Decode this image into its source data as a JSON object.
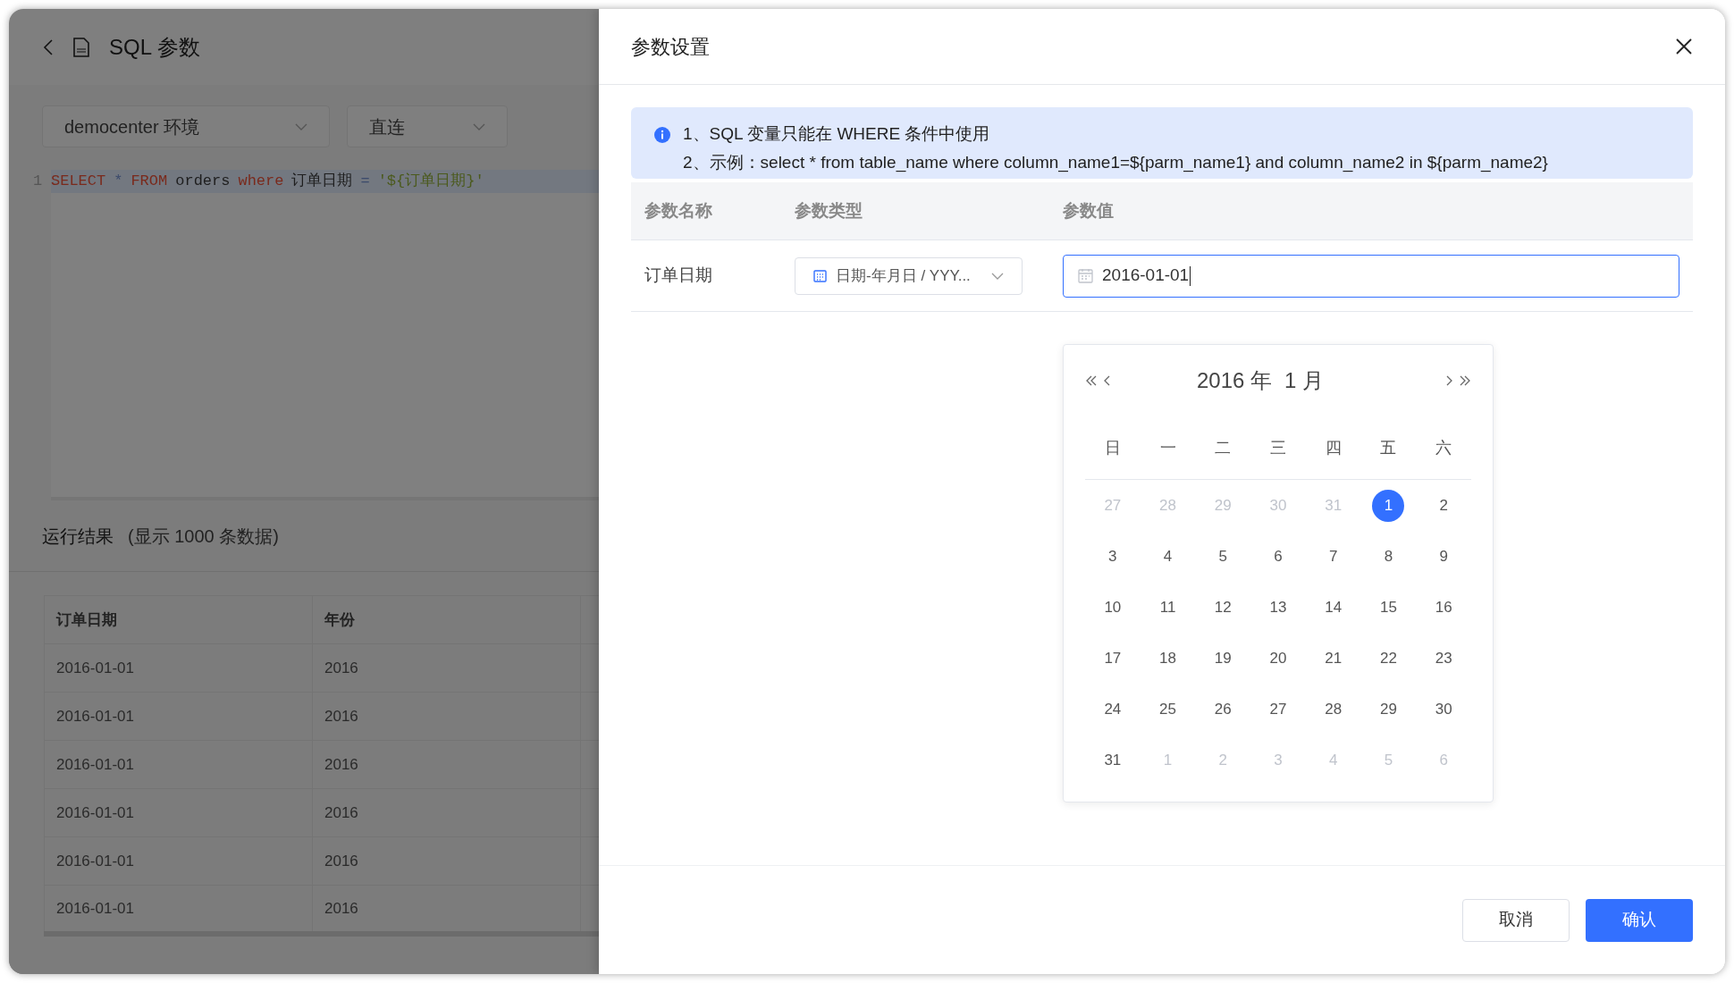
{
  "page": {
    "title": "SQL 参数"
  },
  "toolbar": {
    "environment": "democenter 环境",
    "connection": "直连"
  },
  "editor": {
    "lines": [
      {
        "number": "1",
        "tokens": [
          {
            "kind": "keyword",
            "text": "SELECT"
          },
          {
            "kind": "operator",
            "text": "*"
          },
          {
            "kind": "keyword",
            "text": "FROM"
          },
          {
            "kind": "plain",
            "text": "orders"
          },
          {
            "kind": "keyword",
            "text": "where"
          },
          {
            "kind": "plain",
            "text": "订单日期"
          },
          {
            "kind": "operator",
            "text": "="
          },
          {
            "kind": "string",
            "text": "'${订单日期}'"
          }
        ]
      }
    ]
  },
  "results": {
    "title": "运行结果",
    "note": "(显示 1000 条数据)",
    "columns": [
      "订单日期",
      "年份"
    ],
    "rows": [
      [
        "2016-01-01",
        "2016"
      ],
      [
        "2016-01-01",
        "2016"
      ],
      [
        "2016-01-01",
        "2016"
      ],
      [
        "2016-01-01",
        "2016"
      ],
      [
        "2016-01-01",
        "2016"
      ],
      [
        "2016-01-01",
        "2016"
      ]
    ]
  },
  "drawer": {
    "title": "参数设置",
    "alert": [
      "1、SQL 变量只能在 WHERE 条件中使用",
      "2、示例：select * from table_name where column_name1=${parm_name1} and column_name2 in ${parm_name2}"
    ],
    "columns": [
      "参数名称",
      "参数类型",
      "参数值"
    ],
    "params": [
      {
        "name": "订单日期",
        "type": "日期-年月日 / YYY...",
        "value": "2016-01-01"
      }
    ],
    "buttons": [
      {
        "label": "取消",
        "kind": "secondary"
      },
      {
        "label": "确认",
        "kind": "primary"
      }
    ]
  },
  "calendar": {
    "year": "2016 年",
    "month": "1 月",
    "weekdays": [
      "日",
      "一",
      "二",
      "三",
      "四",
      "五",
      "六"
    ],
    "days": [
      {
        "label": "27",
        "outside": true,
        "selected": false
      },
      {
        "label": "28",
        "outside": true,
        "selected": false
      },
      {
        "label": "29",
        "outside": true,
        "selected": false
      },
      {
        "label": "30",
        "outside": true,
        "selected": false
      },
      {
        "label": "31",
        "outside": true,
        "selected": false
      },
      {
        "label": "1",
        "outside": false,
        "selected": true
      },
      {
        "label": "2",
        "outside": false,
        "selected": false
      },
      {
        "label": "3",
        "outside": false,
        "selected": false
      },
      {
        "label": "4",
        "outside": false,
        "selected": false
      },
      {
        "label": "5",
        "outside": false,
        "selected": false
      },
      {
        "label": "6",
        "outside": false,
        "selected": false
      },
      {
        "label": "7",
        "outside": false,
        "selected": false
      },
      {
        "label": "8",
        "outside": false,
        "selected": false
      },
      {
        "label": "9",
        "outside": false,
        "selected": false
      },
      {
        "label": "10",
        "outside": false,
        "selected": false
      },
      {
        "label": "11",
        "outside": false,
        "selected": false
      },
      {
        "label": "12",
        "outside": false,
        "selected": false
      },
      {
        "label": "13",
        "outside": false,
        "selected": false
      },
      {
        "label": "14",
        "outside": false,
        "selected": false
      },
      {
        "label": "15",
        "outside": false,
        "selected": false
      },
      {
        "label": "16",
        "outside": false,
        "selected": false
      },
      {
        "label": "17",
        "outside": false,
        "selected": false
      },
      {
        "label": "18",
        "outside": false,
        "selected": false
      },
      {
        "label": "19",
        "outside": false,
        "selected": false
      },
      {
        "label": "20",
        "outside": false,
        "selected": false
      },
      {
        "label": "21",
        "outside": false,
        "selected": false
      },
      {
        "label": "22",
        "outside": false,
        "selected": false
      },
      {
        "label": "23",
        "outside": false,
        "selected": false
      },
      {
        "label": "24",
        "outside": false,
        "selected": false
      },
      {
        "label": "25",
        "outside": false,
        "selected": false
      },
      {
        "label": "26",
        "outside": false,
        "selected": false
      },
      {
        "label": "27",
        "outside": false,
        "selected": false
      },
      {
        "label": "28",
        "outside": false,
        "selected": false
      },
      {
        "label": "29",
        "outside": false,
        "selected": false
      },
      {
        "label": "30",
        "outside": false,
        "selected": false
      },
      {
        "label": "31",
        "outside": false,
        "selected": false
      },
      {
        "label": "1",
        "outside": true,
        "selected": false
      },
      {
        "label": "2",
        "outside": true,
        "selected": false
      },
      {
        "label": "3",
        "outside": true,
        "selected": false
      },
      {
        "label": "4",
        "outside": true,
        "selected": false
      },
      {
        "label": "5",
        "outside": true,
        "selected": false
      },
      {
        "label": "6",
        "outside": true,
        "selected": false
      }
    ]
  }
}
